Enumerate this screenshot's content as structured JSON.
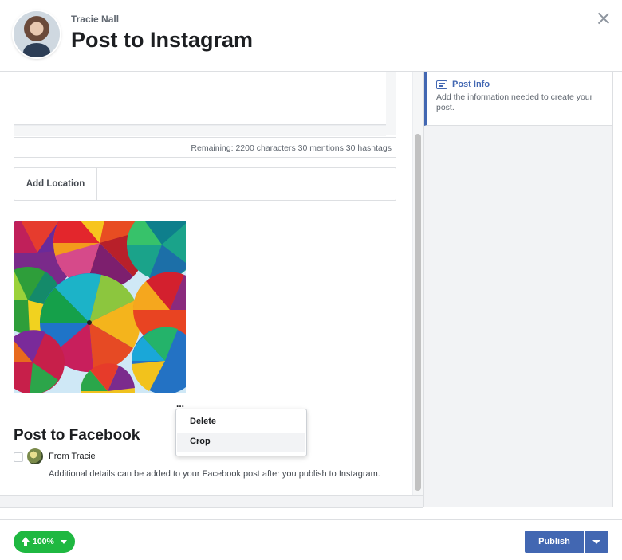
{
  "header": {
    "user_name": "Tracie Nall",
    "title": "Post to Instagram",
    "close_icon": "close-icon"
  },
  "composer": {
    "caption_value": "",
    "remaining_text": "Remaining: 2200 characters 30 mentions 30 hashtags",
    "location_label": "Add Location",
    "location_value": ""
  },
  "media": {
    "image": "colorful-umbrellas-photo",
    "more_options": "..."
  },
  "context_menu": {
    "items": [
      {
        "label": "Delete"
      },
      {
        "label": "Crop"
      }
    ]
  },
  "facebook": {
    "title": "Post to Facebook",
    "from_label": "From Tracie",
    "checked": false,
    "note": "Additional details can be added to your Facebook post after you publish to Instagram."
  },
  "side_panel": {
    "title": "Post Info",
    "description": "Add the information needed to create your post.",
    "accent_color": "#4267b2"
  },
  "footer": {
    "upload_percent": "100%",
    "upload_progress": 1.0,
    "upload_color": "#1fb841",
    "publish_label": "Publish",
    "publish_color": "#4267b2"
  }
}
